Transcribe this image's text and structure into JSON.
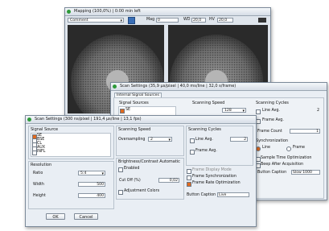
{
  "mapping": {
    "title": "Mapping (100,0%) | 0:00 min left",
    "comment_label": "Comment",
    "mag_label": "Mag",
    "mag_value": "0",
    "wd_label": "WD",
    "wd_value": "20,0",
    "hv_label": "HV",
    "hv_value": "20,0"
  },
  "scan_back": {
    "title": "Scan Settings (35,9 µs/pixel | 40,0 ms/line | 32,0 s/frame)",
    "tab": "Internal Signal Sources",
    "signal_sources": "Signal Sources",
    "se": "SE",
    "scanning_speed": "Scanning Speed",
    "speed_value": "128",
    "scanning_cycles": "Scanning Cycles",
    "line_avg": "Line Avg.",
    "line_avg_value": "2",
    "frame_avg": "Frame Avg.",
    "frame_count": "Frame Count",
    "frame_count_value": "1",
    "synchronization": "Synchronization",
    "line": "Line",
    "frame": "Frame",
    "sample_time_opt": "Sample Time Optimization",
    "beep": "Beep After Acquisition",
    "button_caption_label": "Button Caption",
    "button_caption_value": "Slow 1000"
  },
  "scan_front": {
    "title": "Scan Settings (300 ns/pixel | 191,4 µs/line | 13,1 fps)",
    "signal_source": "Signal Source",
    "sources": [
      "SE",
      "BSE",
      "CL",
      "AUX",
      "INFL"
    ],
    "scanning_speed": "Scanning Speed",
    "oversampling_label": "Oversampling",
    "oversampling_value": "2",
    "scanning_cycles": "Scanning Cycles",
    "line_avg": "Line Avg.",
    "line_avg_value": "2",
    "frame_avg": "Frame Avg.",
    "resolution": "Resolution",
    "ratio_label": "Ratio",
    "ratio_value": "5:4",
    "width_label": "Width",
    "width_value": "500",
    "height_label": "Height",
    "height_value": "400",
    "brightness": "Brightness/Contrast Automatic",
    "enabled": "Enabled",
    "cutoff_label": "Cut Off (%)",
    "cutoff_value": "0,02",
    "adjustment_colors": "Adjustment Colors",
    "frame_display_mode": "Frame Display Mode",
    "frame_sync": "Frame Synchronization",
    "frame_rate_opt": "Frame Rate Optimization",
    "button_caption_label": "Button Caption",
    "button_caption_value": "Live",
    "ok": "OK",
    "cancel": "Cancel"
  },
  "colors": {
    "accent": "#e06a1f",
    "titlebar": "#d6dde6",
    "window_bg": "#e9eef4"
  }
}
